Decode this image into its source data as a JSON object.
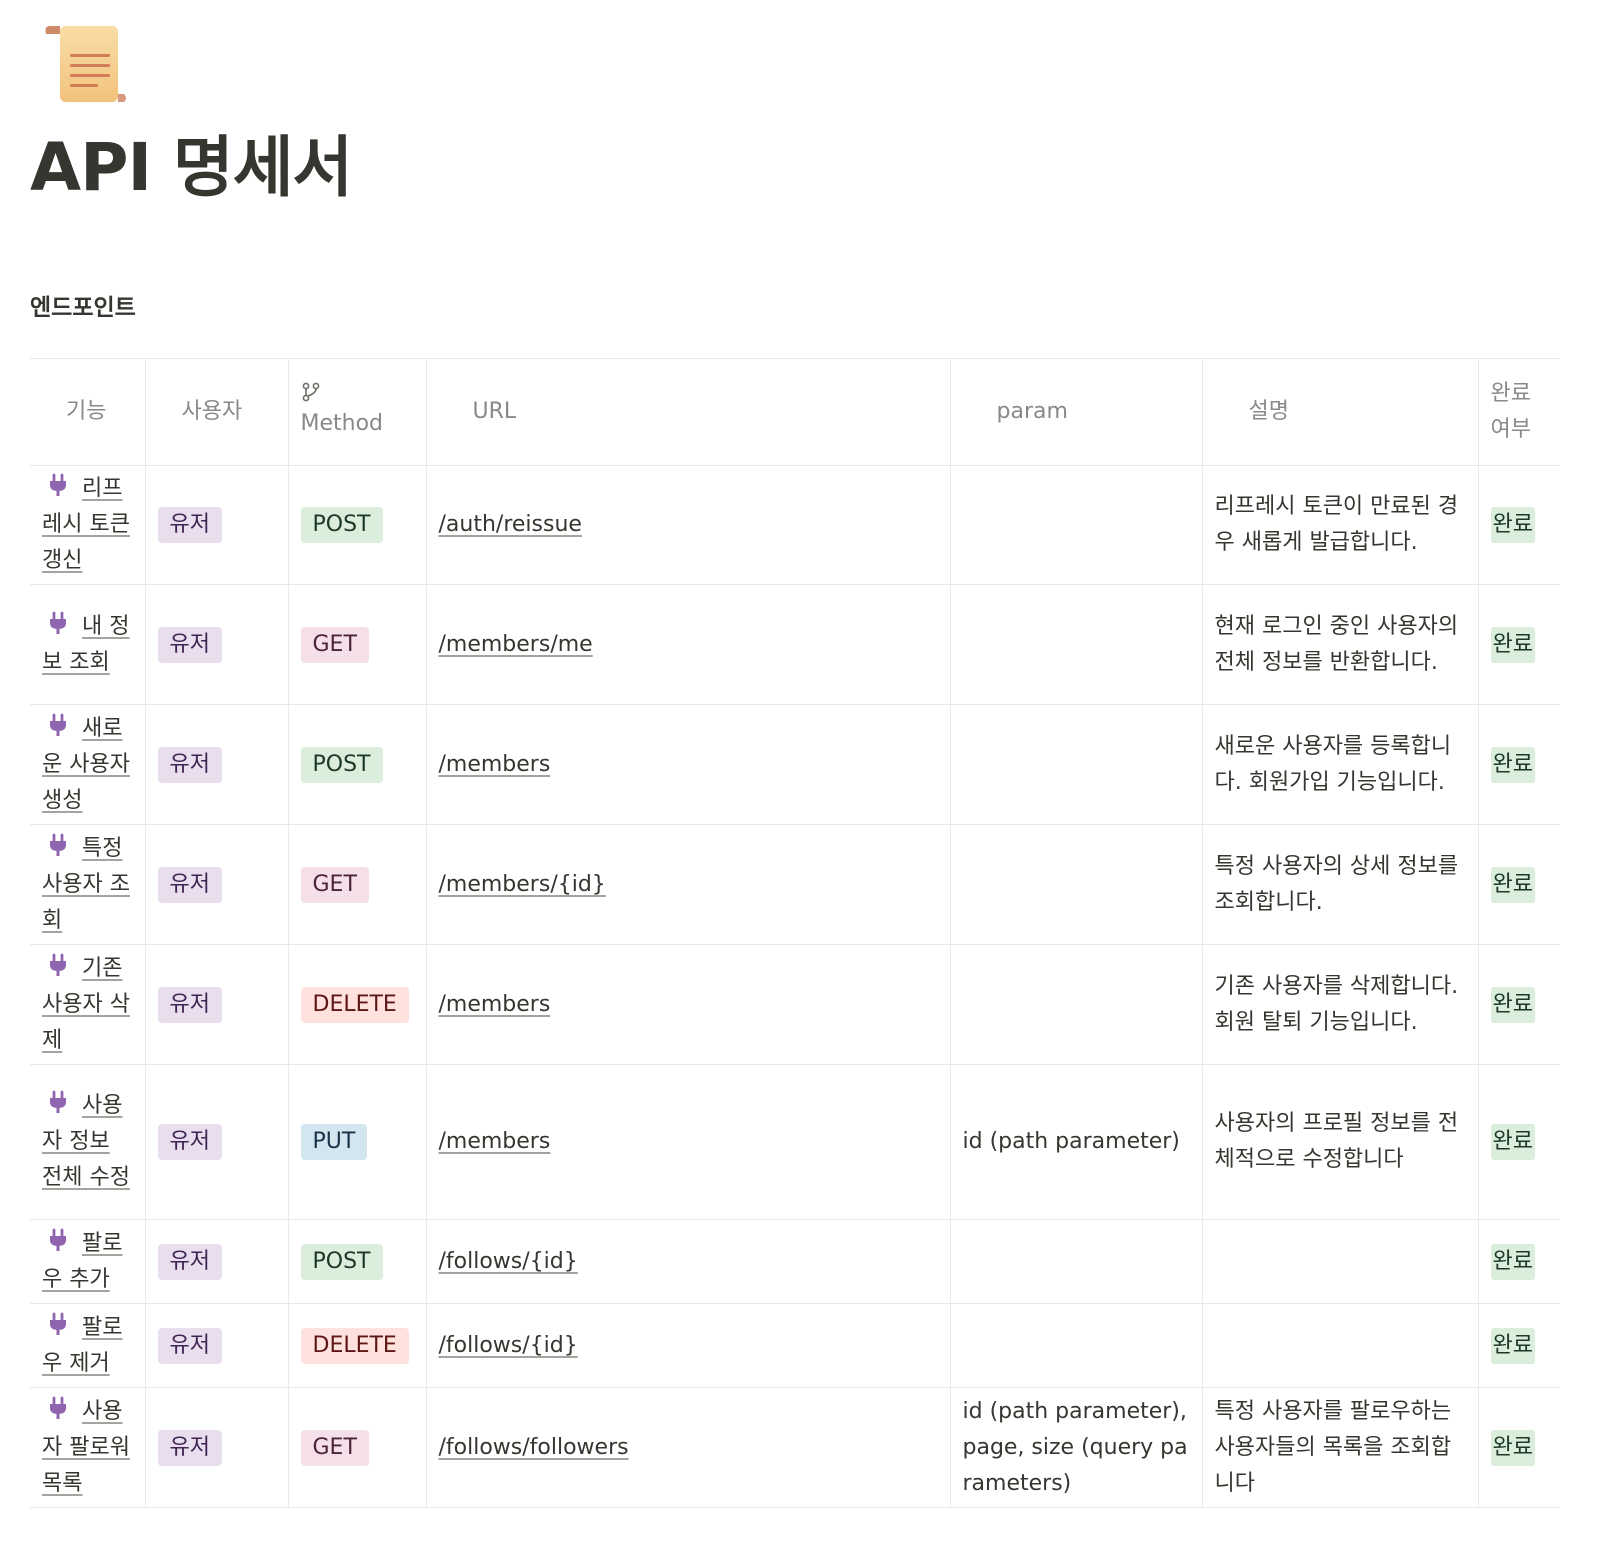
{
  "page": {
    "icon": "scroll-icon",
    "title": "API 명세서",
    "section_title": "엔드포인트"
  },
  "table": {
    "headers": {
      "feature": "기능",
      "user": "사용자",
      "method": "Method",
      "url": "URL",
      "param": "param",
      "description": "설명",
      "done": "완료 여부"
    },
    "header_icons": {
      "feature": "text-icon",
      "user": "select-icon",
      "method": "branch-icon",
      "url": "link-icon",
      "param": "text-icon",
      "description": "text-icon",
      "done": "select-icon"
    },
    "rows": [
      {
        "feature": "리프레시 토큰 갱신",
        "user": "유저",
        "method": "POST",
        "url": "/auth/reissue",
        "param": "",
        "description": "리프레시 토큰이 만료된 경우 새롭게 발급합니다.",
        "done": "완료"
      },
      {
        "feature": "내 정보 조회",
        "user": "유저",
        "method": "GET",
        "url": "/members/me",
        "param": "",
        "description": "현재 로그인 중인 사용자의 전체 정보를 반환합니다.",
        "done": "완료"
      },
      {
        "feature": "새로운 사용자 생성",
        "user": "유저",
        "method": "POST",
        "url": "/members",
        "param": "",
        "description": "새로운 사용자를 등록합니다. 회원가입 기능입니다.",
        "done": "완료"
      },
      {
        "feature": "특정 사용자 조회",
        "user": "유저",
        "method": "GET",
        "url": "/members/{id}",
        "param": "",
        "description": "특정 사용자의 상세 정보를 조회합니다.",
        "done": "완료"
      },
      {
        "feature": "기존 사용자 삭제",
        "user": "유저",
        "method": "DELETE",
        "url": "/members",
        "param": "",
        "description": "기존 사용자를 삭제합니다. 회원 탈퇴 기능입니다.",
        "done": "완료"
      },
      {
        "feature": "사용자 정보 전체 수정",
        "user": "유저",
        "method": "PUT",
        "url": "/members",
        "param": "id (path parameter)",
        "description": "사용자의 프로필 정보를 전체적으로 수정합니다",
        "done": "완료"
      },
      {
        "feature": "팔로우 추가",
        "user": "유저",
        "method": "POST",
        "url": "/follows/{id}",
        "param": "",
        "description": "",
        "done": "완료"
      },
      {
        "feature": "팔로우 제거",
        "user": "유저",
        "method": "DELETE",
        "url": "/follows/{id}",
        "param": "",
        "description": "",
        "done": "완료"
      },
      {
        "feature": "사용자 팔로워 목록",
        "user": "유저",
        "method": "GET",
        "url": "/follows/followers",
        "param": "id (path parameter), page, size (query parameters)",
        "description": "특정 사용자를 팔로우하는 사용자들의 목록을 조회합니다",
        "done": "완료"
      }
    ]
  },
  "colors": {
    "user_tag": "#e8deee",
    "post_tag": "#dbeddb",
    "get_tag": "#f5e0e9",
    "delete_tag": "#ffe2dd",
    "put_tag": "#d3e5ef",
    "done_tag": "#dbeddb",
    "plug_icon": "#9065b0"
  }
}
